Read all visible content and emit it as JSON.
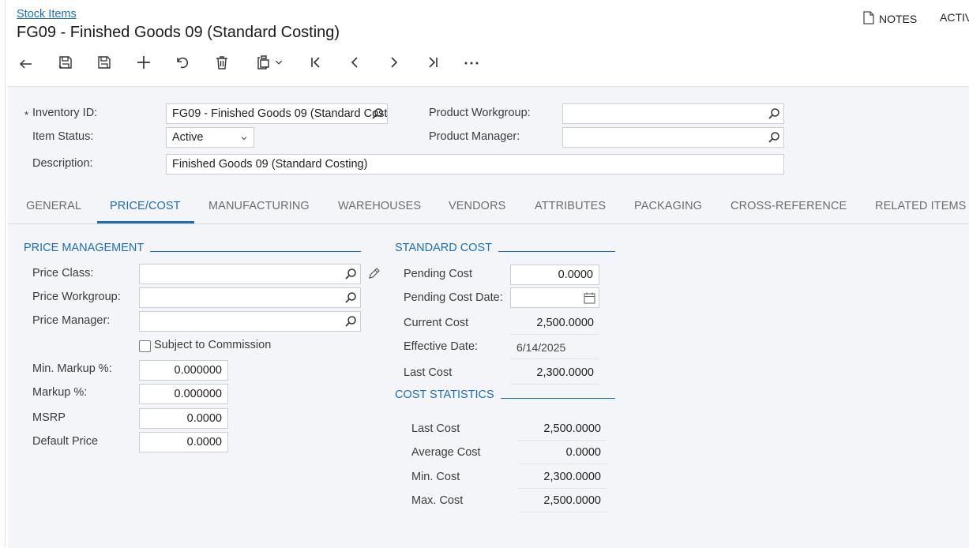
{
  "header": {
    "breadcrumb": "Stock Items",
    "title": "FG09 - Finished Goods 09 (Standard Costing)",
    "notes_label": "NOTES",
    "activities_label": "ACTIV"
  },
  "toolbar": {
    "icons": [
      "back-icon",
      "save-close-icon",
      "save-icon",
      "add-icon",
      "undo-icon",
      "delete-icon",
      "copy-paste-icon",
      "first-record-icon",
      "previous-icon",
      "next-icon",
      "last-record-icon",
      "more-icon"
    ]
  },
  "summary": {
    "inventory_id_label": "Inventory ID:",
    "inventory_id_value": "FG09 - Finished Goods 09 (Standard Costing)",
    "item_status_label": "Item Status:",
    "item_status_value": "Active",
    "description_label": "Description:",
    "description_value": "Finished Goods 09 (Standard Costing)",
    "product_workgroup_label": "Product Workgroup:",
    "product_workgroup_value": "",
    "product_manager_label": "Product Manager:",
    "product_manager_value": "",
    "required_mark": "*"
  },
  "tabs": [
    {
      "label": "GENERAL",
      "active": false
    },
    {
      "label": "PRICE/COST",
      "active": true
    },
    {
      "label": "MANUFACTURING",
      "active": false
    },
    {
      "label": "WAREHOUSES",
      "active": false
    },
    {
      "label": "VENDORS",
      "active": false
    },
    {
      "label": "ATTRIBUTES",
      "active": false
    },
    {
      "label": "PACKAGING",
      "active": false
    },
    {
      "label": "CROSS-REFERENCE",
      "active": false
    },
    {
      "label": "RELATED ITEMS",
      "active": false
    }
  ],
  "price_management": {
    "title": "PRICE MANAGEMENT",
    "price_class_label": "Price Class:",
    "price_class_value": "",
    "price_workgroup_label": "Price Workgroup:",
    "price_workgroup_value": "",
    "price_manager_label": "Price Manager:",
    "price_manager_value": "",
    "subject_to_commission_label": "Subject to Commission",
    "subject_to_commission_checked": false,
    "min_markup_label": "Min. Markup %:",
    "min_markup_value": "0.000000",
    "markup_label": "Markup %:",
    "markup_value": "0.000000",
    "msrp_label": "MSRP",
    "msrp_value": "0.0000",
    "default_price_label": "Default Price",
    "default_price_value": "0.0000"
  },
  "standard_cost": {
    "title": "STANDARD COST",
    "pending_cost_label": "Pending Cost",
    "pending_cost_value": "0.0000",
    "pending_cost_date_label": "Pending Cost Date:",
    "pending_cost_date_value": "",
    "current_cost_label": "Current Cost",
    "current_cost_value": "2,500.0000",
    "effective_date_label": "Effective Date:",
    "effective_date_value": "6/14/2025",
    "last_cost_label": "Last Cost",
    "last_cost_value": "2,300.0000"
  },
  "cost_statistics": {
    "title": "COST STATISTICS",
    "last_cost_label": "Last Cost",
    "last_cost_value": "2,500.0000",
    "average_cost_label": "Average Cost",
    "average_cost_value": "0.0000",
    "min_cost_label": "Min. Cost",
    "min_cost_value": "2,300.0000",
    "max_cost_label": "Max. Cost",
    "max_cost_value": "2,500.0000"
  },
  "colors": {
    "accent": "#1b6fb5",
    "panel_bg": "#f3f5f8",
    "border": "#c9ced4"
  }
}
